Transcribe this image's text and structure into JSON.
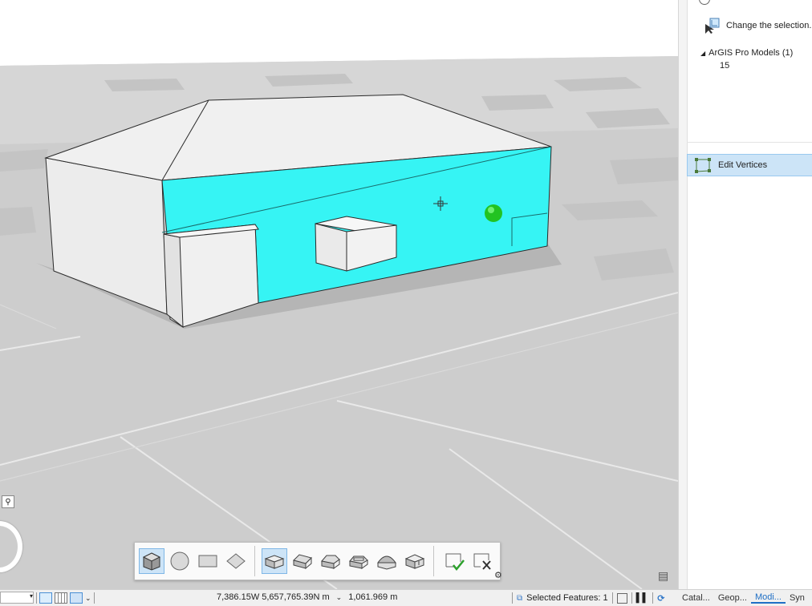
{
  "pane": {
    "change_selection": "Change the selection.",
    "tree_parent": "ArGIS Pro Models (1)",
    "tree_child": "15",
    "tool_label": "Edit Vertices"
  },
  "status": {
    "coordinates": "7,386.15W 5,657,765.39N m",
    "elevation": "1,061.969 m",
    "selected_features": "Selected Features: 1"
  },
  "pane_tabs": [
    {
      "label": "Catal..."
    },
    {
      "label": "Geop..."
    },
    {
      "label": "Modi..."
    },
    {
      "label": "Syn"
    }
  ],
  "toolbar": {
    "groups": [
      "shape-tools",
      "roof-tools",
      "finish-tools"
    ]
  },
  "colors": {
    "selected_face": "#36f4f4",
    "vertex_handle": "#22c322",
    "ground": "#cfcfcf",
    "tool_highlight": "#cce4f7"
  }
}
